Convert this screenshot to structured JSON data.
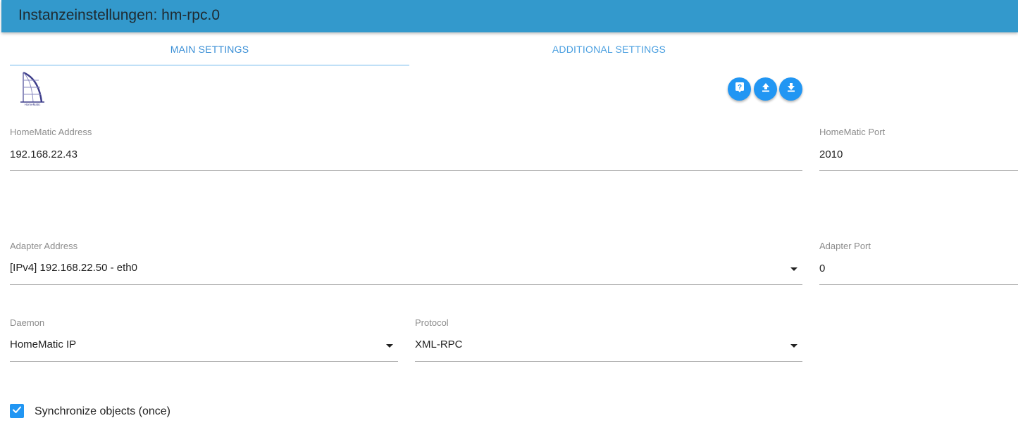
{
  "header": {
    "title": "Instanzeinstellungen: hm-rpc.0"
  },
  "tabs": [
    {
      "label": "MAIN SETTINGS"
    },
    {
      "label": "ADDITIONAL SETTINGS"
    }
  ],
  "logo": {
    "text": "HomeMatic"
  },
  "toolbar": {
    "help_icon": "help-icon",
    "upload_icon": "upload-icon",
    "download_icon": "download-icon",
    "accent_color": "#2196f3"
  },
  "fields": {
    "homematic_address": {
      "label": "HomeMatic Address",
      "value": "192.168.22.43"
    },
    "homematic_port": {
      "label": "HomeMatic Port",
      "value": "2010"
    },
    "adapter_address": {
      "label": "Adapter Address",
      "value": "[IPv4] 192.168.22.50 - eth0"
    },
    "adapter_port": {
      "label": "Adapter Port",
      "value": "0"
    },
    "daemon": {
      "label": "Daemon",
      "value": "HomeMatic IP"
    },
    "protocol": {
      "label": "Protocol",
      "value": "XML-RPC"
    }
  },
  "sync": {
    "label": "Synchronize objects (once)",
    "checked": true
  },
  "colors": {
    "header": "#3399cc",
    "tab_text": "#3a8fd6"
  }
}
